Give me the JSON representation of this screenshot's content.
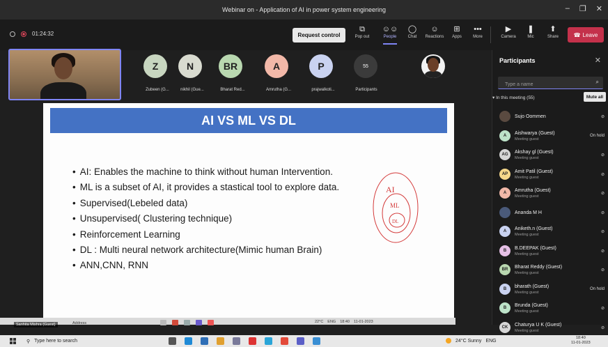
{
  "window": {
    "title": "Webinar on - Application of AI in power system engineering",
    "minimize": "–",
    "maximize": "❐",
    "close": "✕"
  },
  "toolbar": {
    "timer": "01:24:32",
    "request_control": "Request control",
    "items": [
      {
        "label": "Pop out",
        "icon": "popout-icon",
        "glyph": "⧉"
      },
      {
        "label": "People",
        "icon": "people-icon",
        "glyph": "👥"
      },
      {
        "label": "Chat",
        "icon": "chat-icon",
        "glyph": "💬"
      },
      {
        "label": "Reactions",
        "icon": "reactions-icon",
        "glyph": "☺"
      },
      {
        "label": "Apps",
        "icon": "apps-icon",
        "glyph": "⊞"
      },
      {
        "label": "More",
        "icon": "more-icon",
        "glyph": "•••"
      },
      {
        "label": "Camera",
        "icon": "camera-icon",
        "glyph": "▶"
      },
      {
        "label": "Mic",
        "icon": "mic-icon",
        "glyph": "🎙"
      },
      {
        "label": "Share",
        "icon": "share-icon",
        "glyph": "⬆"
      }
    ],
    "leave": "Leave",
    "accent": "#7f85f5",
    "leave_color": "#c4314b"
  },
  "roster": [
    {
      "initial": "Z",
      "name": "Zubeen (G...",
      "color": "#c8d6c0"
    },
    {
      "initial": "N",
      "name": "nikhil (Gue...",
      "color": "#d9dbd0"
    },
    {
      "initial": "BR",
      "name": "Bharat Red...",
      "color": "#b9d8b0"
    },
    {
      "initial": "A",
      "name": "Amrutha (G...",
      "color": "#f2b8a8"
    },
    {
      "initial": "P",
      "name": "prajwalkoti...",
      "color": "#c9d2f0"
    }
  ],
  "participants_count": "55",
  "participants_label": "Participants",
  "slide": {
    "title": "AI VS ML VS DL",
    "bullets": [
      "AI: Enables the machine to think without human Intervention.",
      "ML is a subset of AI, it provides a stastical tool to explore data.",
      "Supervised(Lebeled data)",
      "Unsupervised( Clustering technique)",
      "Reinforcement Learning",
      "DL  : Multi neural network architecture(Mimic human Brain)",
      "ANN,CNN, RNN"
    ],
    "sketch": {
      "outer": "AI",
      "middle": "ML",
      "inner": "DL"
    }
  },
  "inner_screen": {
    "presenter_label": "Sanhita Mishra (Guest)",
    "address": "Address",
    "weather": "22°C",
    "lang": "ENG",
    "time": "18:40",
    "date": "11-01-2023"
  },
  "panel": {
    "title": "Participants",
    "search_placeholder": "Type a name",
    "in_meeting": "In this meeting (55)",
    "mute_all": "Mute all",
    "people": [
      {
        "name": "Sujo Oommen",
        "sub": "",
        "initials": "",
        "color": "",
        "status": "mic-off",
        "photo": true
      },
      {
        "name": "Aishwarya (Guest)",
        "sub": "Meeting guest",
        "initials": "A",
        "color": "#bde3c9",
        "status": "On hold"
      },
      {
        "name": "Akshay gl (Guest)",
        "sub": "Meeting guest",
        "initials": "AG",
        "color": "#d6d6d6",
        "status": "mic-off"
      },
      {
        "name": "Amit Patil (Guest)",
        "sub": "Meeting guest",
        "initials": "AP",
        "color": "#f5d78a",
        "status": "mic-off"
      },
      {
        "name": "Amrutha (Guest)",
        "sub": "Meeting guest",
        "initials": "A",
        "color": "#f2b8a8",
        "status": "mic-off"
      },
      {
        "name": "Ananda M H",
        "sub": "",
        "initials": "",
        "color": "",
        "status": "mic-off",
        "photo": true
      },
      {
        "name": "Aniketh.n (Guest)",
        "sub": "Meeting guest",
        "initials": "A",
        "color": "#c9d2f0",
        "status": "mic-off"
      },
      {
        "name": "B.DEEPAK (Guest)",
        "sub": "Meeting guest",
        "initials": "B",
        "color": "#e6c0e6",
        "status": "mic-off"
      },
      {
        "name": "Bharat Reddy (Guest)",
        "sub": "Meeting guest",
        "initials": "BR",
        "color": "#b9d8b0",
        "status": "mic-off"
      },
      {
        "name": "bharath (Guest)",
        "sub": "Meeting guest",
        "initials": "B",
        "color": "#c9d2f0",
        "status": "On hold"
      },
      {
        "name": "Brunda (Guest)",
        "sub": "Meeting guest",
        "initials": "B",
        "color": "#bde3c9",
        "status": "mic-off"
      },
      {
        "name": "Chaturya U K (Guest)",
        "sub": "Meeting guest",
        "initials": "CK",
        "color": "#d6d6d6",
        "status": "mic-off"
      }
    ]
  },
  "taskbar": {
    "search_placeholder": "Type here to search",
    "weather": "24°C  Sunny",
    "lang": "ENG",
    "time": "18:40",
    "date": "11-01-2023"
  }
}
